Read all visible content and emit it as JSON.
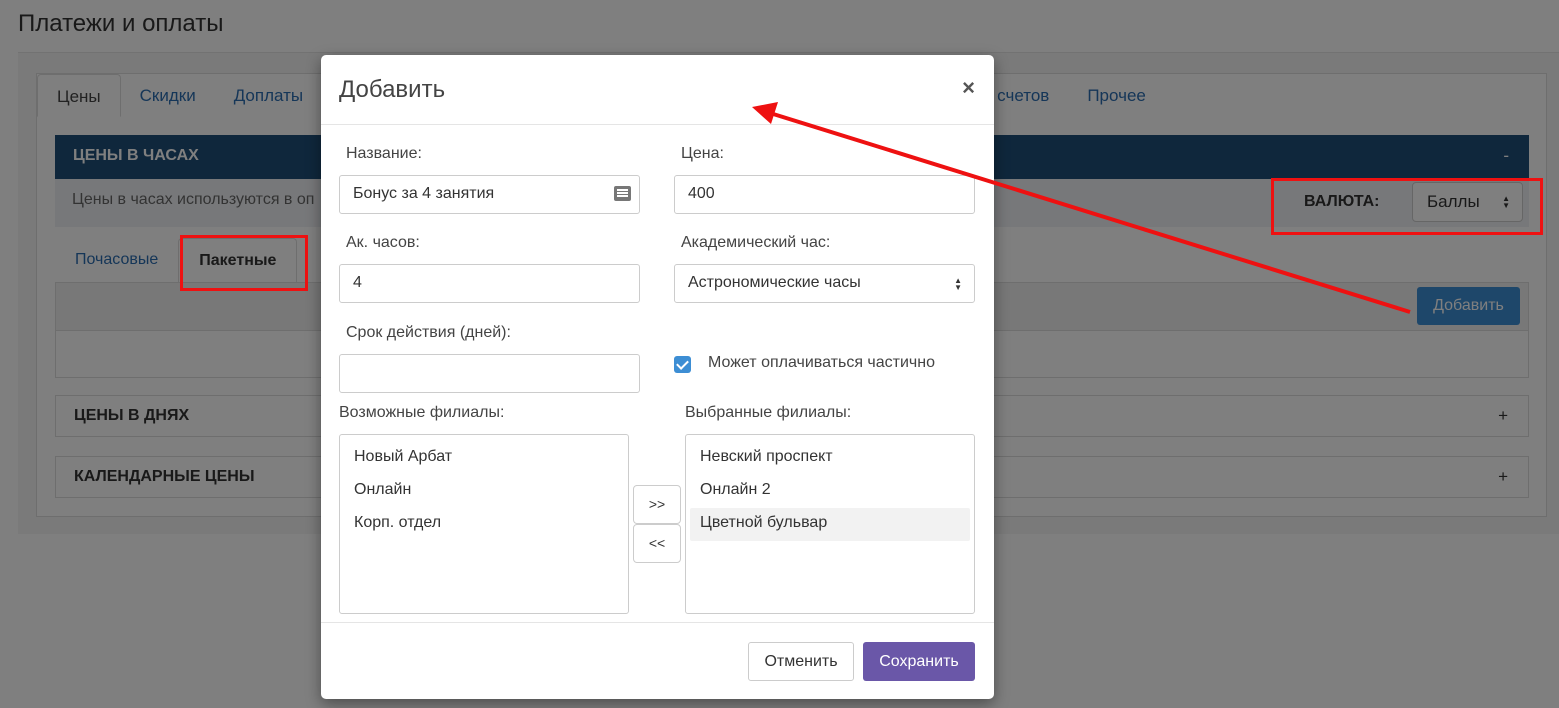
{
  "page": {
    "title": "Платежи и оплаты"
  },
  "tabs": [
    {
      "label": "Цены",
      "active": true
    },
    {
      "label": "Скидки"
    },
    {
      "label": "Доплаты"
    }
  ],
  "tabs_right": [
    {
      "label": "е счетов"
    },
    {
      "label": "Прочее"
    }
  ],
  "hours_section": {
    "title": "ЦЕНЫ В ЧАСАХ",
    "toggle": "-",
    "info": "Цены в часах используются в оп"
  },
  "currency": {
    "label": "ВАЛЮТА:",
    "value": "Баллы"
  },
  "subtabs": [
    {
      "label": "Почасовые"
    },
    {
      "label": "Пакетные",
      "active": true
    }
  ],
  "add_button": "Добавить",
  "days_section": {
    "title": "ЦЕНЫ В ДНЯХ",
    "toggle": "+"
  },
  "calendar_section": {
    "title": "КАЛЕНДАРНЫЕ ЦЕНЫ",
    "toggle": "+"
  },
  "modal": {
    "title": "Добавить",
    "close": "×",
    "name_label": "Название:",
    "name_value": "Бонус за 4 занятия",
    "price_label": "Цена:",
    "price_value": "400",
    "hours_label": "Ак. часов:",
    "hours_value": "4",
    "acad_hour_label": "Академический час:",
    "acad_hour_value": "Астрономические часы",
    "validity_label": "Срок действия (дней):",
    "validity_value": "",
    "partial_label": "Может оплачиваться частично",
    "partial_checked": true,
    "available_label": "Возможные филиалы:",
    "available": [
      "Новый Арбат",
      "Онлайн",
      "Корп. отдел"
    ],
    "selected_label": "Выбранные филиалы:",
    "selected": [
      "Невский проспект",
      "Онлайн 2",
      "Цветной бульвар"
    ],
    "move_right": ">>",
    "move_left": "<<",
    "cancel": "Отменить",
    "save": "Сохранить"
  },
  "colors": {
    "header_bar": "#1f4e79",
    "primary_button": "#3d8ed4",
    "save_button": "#6a57a8",
    "annotation": "#ee1111"
  }
}
